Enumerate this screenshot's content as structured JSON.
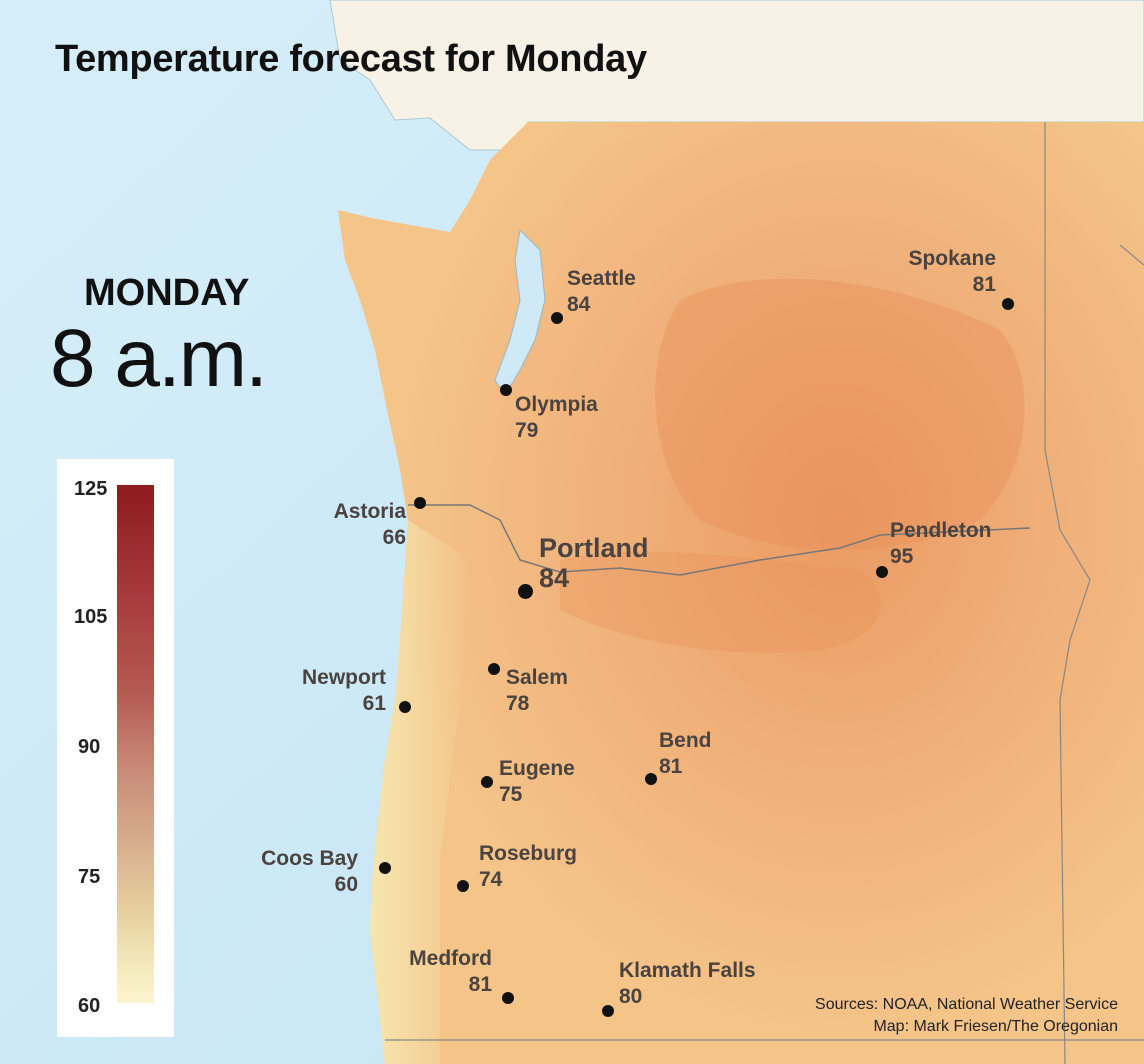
{
  "title": "Temperature forecast for Monday",
  "day": "MONDAY",
  "time": "8 a.m.",
  "legend": {
    "ticks": [
      "125",
      "105",
      "90",
      "75",
      "60"
    ]
  },
  "cities": {
    "seattle": {
      "name": "Seattle",
      "temp": "84"
    },
    "spokane": {
      "name": "Spokane",
      "temp": "81"
    },
    "olympia": {
      "name": "Olympia",
      "temp": "79"
    },
    "astoria": {
      "name": "Astoria",
      "temp": "66"
    },
    "portland": {
      "name": "Portland",
      "temp": "84"
    },
    "pendleton": {
      "name": "Pendleton",
      "temp": "95"
    },
    "newport": {
      "name": "Newport",
      "temp": "61"
    },
    "salem": {
      "name": "Salem",
      "temp": "78"
    },
    "bend": {
      "name": "Bend",
      "temp": "81"
    },
    "eugene": {
      "name": "Eugene",
      "temp": "75"
    },
    "coosbay": {
      "name": "Coos Bay",
      "temp": "60"
    },
    "roseburg": {
      "name": "Roseburg",
      "temp": "74"
    },
    "medford": {
      "name": "Medford",
      "temp": "81"
    },
    "klamath": {
      "name": "Klamath Falls",
      "temp": "80"
    }
  },
  "sources": {
    "line1": "Sources: NOAA, National Weather Service",
    "line2": "Map: Mark Friesen/The Oregonian"
  },
  "colors": {
    "ocean": "#cfe9f6",
    "canada": "#f7f1e6",
    "heat_low": "#fbf5cf",
    "heat_high": "#8e1b1e"
  }
}
